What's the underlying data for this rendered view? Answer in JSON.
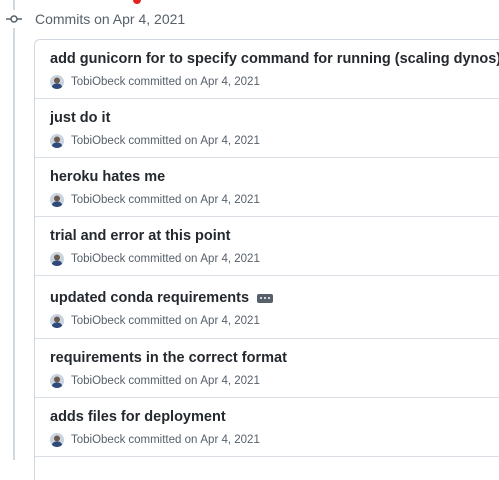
{
  "group": {
    "title": "Commits on Apr 4, 2021"
  },
  "commits": [
    {
      "message": "add gunicorn for to specify command for running (scaling dynos)",
      "author": "TobiObeck",
      "action": "committed on",
      "date": "Apr 4, 2021"
    },
    {
      "message": "just do it",
      "author": "TobiObeck",
      "action": "committed on",
      "date": "Apr 4, 2021"
    },
    {
      "message": "heroku hates me",
      "author": "TobiObeck",
      "action": "committed on",
      "date": "Apr 4, 2021"
    },
    {
      "message": "trial and error at this point",
      "author": "TobiObeck",
      "action": "committed on",
      "date": "Apr 4, 2021"
    },
    {
      "message": "updated conda requirements",
      "author": "TobiObeck",
      "action": "committed on",
      "date": "Apr 4, 2021",
      "has_more": true
    },
    {
      "message": "requirements in the correct format",
      "author": "TobiObeck",
      "action": "committed on",
      "date": "Apr 4, 2021"
    },
    {
      "message": "adds files for deployment",
      "author": "TobiObeck",
      "action": "committed on",
      "date": "Apr 4, 2021"
    }
  ],
  "icons": {
    "group": "git-commit-icon",
    "more": "kebab-ellipsis-icon",
    "avatar": "user-avatar"
  },
  "colors": {
    "text": "#24292f",
    "muted": "#57606a",
    "border": "#d0d7de",
    "accent_mark": "#e5201f"
  }
}
